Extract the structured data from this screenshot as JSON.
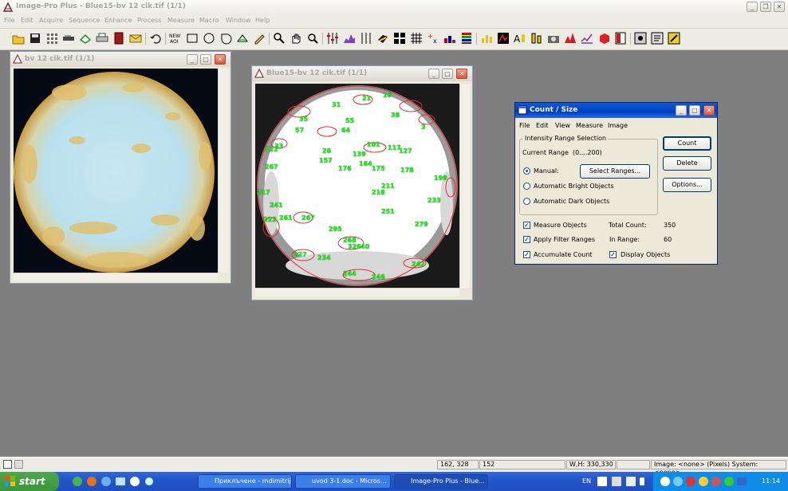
{
  "app": {
    "title": "Image-Pro Plus - Blue15-bv 12 cik.tif (1/1)"
  },
  "menu": [
    "File",
    "Edit",
    "Acquire",
    "Sequence",
    "Enhance",
    "Process",
    "Measure",
    "Macro",
    "Window",
    "Help"
  ],
  "window1": {
    "title": "bv 12 cik.tif (1/1)"
  },
  "window2": {
    "title": "Blue15-bv 12 cik.tif (1/1)",
    "blob_labels": [
      "31",
      "21",
      "16",
      "38",
      "35",
      "55",
      "64",
      "57",
      "26",
      "122",
      "139",
      "101",
      "117",
      "127",
      "157",
      "176",
      "164",
      "175",
      "178",
      "199",
      "267",
      "217",
      "211",
      "218",
      "233",
      "241",
      "251",
      "222",
      "261",
      "267",
      "295",
      "279",
      "268",
      "326",
      "40",
      "227",
      "234",
      "244",
      "246",
      "242",
      "3",
      "33"
    ]
  },
  "count_size": {
    "title": "Count / Size",
    "menu": [
      "File",
      "Edit",
      "View",
      "Measure",
      "Image"
    ],
    "group_title": "Intensity Range Selection",
    "current_range_label": "Current Range",
    "current_range_value": "(0....200)",
    "radio_manual": "Manual:",
    "select_ranges_button": "Select Ranges...",
    "radio_bright": "Automatic Bright Objects",
    "radio_dark": "Automatic Dark Objects",
    "count_button": "Count",
    "delete_button": "Delete",
    "options_button": "Options...",
    "measure_objects": "Measure Objects",
    "apply_filter": "Apply Filter Ranges",
    "accumulate_count": "Accumulate Count",
    "display_objects": "Display Objects",
    "total_count_label": "Total Count:",
    "total_count_value": "350",
    "in_range_label": "In Range:",
    "in_range_value": "60"
  },
  "status": {
    "coords": "162, 328",
    "value": "152",
    "wh": "W,H: 330,330",
    "image_info": "Image: <none> (Pixels) System: <none>"
  },
  "taskbar": {
    "start": "start",
    "tasks": [
      "Приклъчене - mdimitrij...",
      "uvod 3-1.doc - Micros...",
      "Image-Pro Plus - Blue..."
    ],
    "lang": "EN",
    "clock": "11:14"
  },
  "colors": {
    "blob_label": "#14ff14",
    "outline": "#e03030",
    "xp_blue": "#2457ca"
  }
}
